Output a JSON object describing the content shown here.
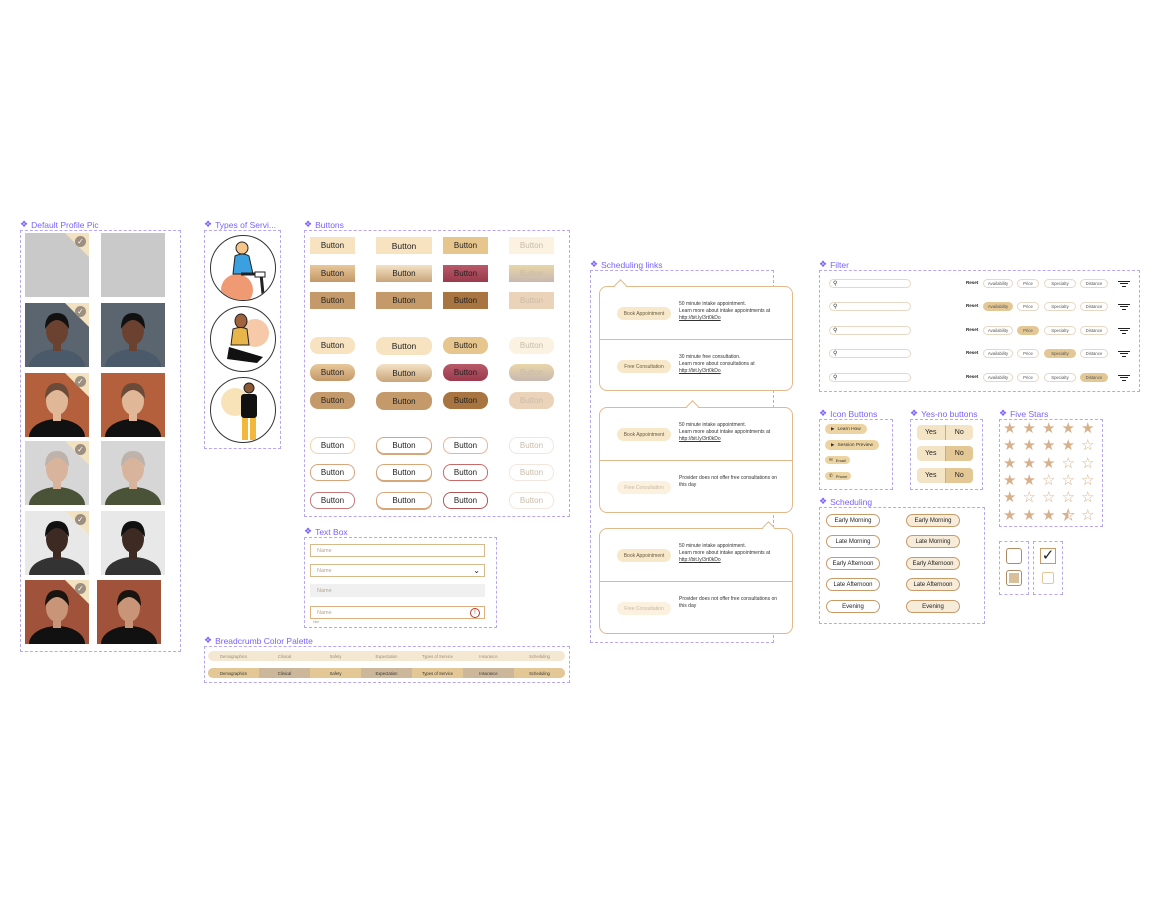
{
  "frames": {
    "profile": "Default Profile Pic",
    "types": "Types of Servi...",
    "buttons": "Buttons",
    "textbox": "Text Box",
    "breadcrumb": "Breadcrumb Color Palette",
    "scheduling_links": "Scheduling links",
    "filter": "Filter",
    "icon_buttons": "Icon Buttons",
    "yes_no": "Yes-no buttons",
    "five_stars": "Five Stars",
    "scheduling": "Scheduling"
  },
  "button_label": "Button",
  "textbox": {
    "placeholder": "Name",
    "error_hint": "Hint"
  },
  "breadcrumb": [
    "Demographics",
    "Clinical",
    "Safety",
    "Expectation",
    "Types of Service",
    "Insurance",
    "Scheduling"
  ],
  "scheduling_links": [
    {
      "slot": "Book Appointment",
      "text": "50 minute intake appointment.",
      "text2": "Learn more about intake appointments at",
      "link": "http://bit.ly/3rt0kDo",
      "dim": false
    },
    {
      "slot": "Free Consultation",
      "text": "30 minute free consultation.",
      "text2": "Learn more about consultations at",
      "link": "http://bit.ly/3rt0kDo",
      "dim": false
    },
    {
      "slot": "Book Appointment",
      "text": "50 minute intake appointment.",
      "text2": "Learn more about intake appointments at",
      "link": "http://bit.ly/3rt0kDo",
      "dim": false
    },
    {
      "slot": "Free Consultation",
      "text": "Provider does not offer free consultations on",
      "text2": "this day",
      "link": "",
      "dim": true
    },
    {
      "slot": "Book Appointment",
      "text": "50 minute intake appointment.",
      "text2": "Learn more about intake appointments at",
      "link": "http://bit.ly/3rt0kDo",
      "dim": false
    },
    {
      "slot": "Free Consultation",
      "text": "Provider does not offer free consultations on",
      "text2": "this day",
      "link": "",
      "dim": true
    }
  ],
  "filter": {
    "reset": "Reset",
    "chips": [
      "Availability",
      "Price",
      "Specialty",
      "Distance"
    ],
    "active_rows": [
      -1,
      0,
      1,
      2,
      3
    ]
  },
  "icon_buttons": [
    {
      "label": "Learn How",
      "icon": "play-icon"
    },
    {
      "label": "Session Preview",
      "icon": "play-icon"
    },
    {
      "label": "Email",
      "icon": "mail-icon"
    },
    {
      "label": "Phone",
      "icon": "phone-icon"
    }
  ],
  "yes_no": {
    "yes": "Yes",
    "no": "No"
  },
  "stars": [
    5,
    4,
    3,
    2,
    1,
    3.5
  ],
  "scheduling": [
    "Early Morning",
    "Late Morning",
    "Early Afternoon",
    "Late Afternoon",
    "Evening"
  ],
  "colors": {
    "accent": "#7b61ff",
    "tan": "#e3c896",
    "brown": "#b98a5a",
    "cream": "#f7e8c9"
  }
}
